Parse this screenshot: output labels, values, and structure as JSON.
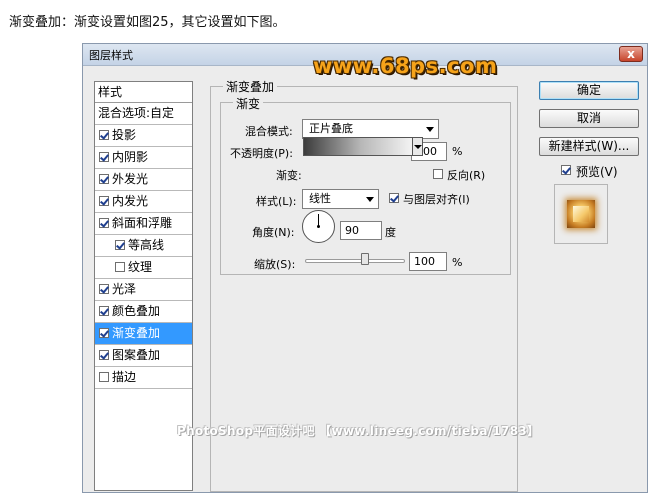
{
  "intro_text": "渐变叠加：渐变设置如图25，其它设置如下图。",
  "dialog": {
    "title": "图层样式",
    "close_glyph": "x",
    "logo": "www.68ps.com"
  },
  "styles_panel": {
    "header": "样式",
    "blend_options": "混合选项:自定",
    "items": [
      {
        "label": "投影",
        "checked": true
      },
      {
        "label": "内阴影",
        "checked": true
      },
      {
        "label": "外发光",
        "checked": true
      },
      {
        "label": "内发光",
        "checked": true
      },
      {
        "label": "斜面和浮雕",
        "checked": true
      },
      {
        "label": "等高线",
        "checked": true
      },
      {
        "label": "纹理",
        "checked": false
      },
      {
        "label": "光泽",
        "checked": true
      },
      {
        "label": "颜色叠加",
        "checked": true
      },
      {
        "label": "渐变叠加",
        "checked": true,
        "selected": true
      },
      {
        "label": "图案叠加",
        "checked": true
      },
      {
        "label": "描边",
        "checked": false
      }
    ]
  },
  "gradient_overlay": {
    "section_title": "渐变叠加",
    "subsection_title": "渐变",
    "blend_mode_label": "混合模式:",
    "blend_mode_value": "正片叠底",
    "opacity_label": "不透明度(P):",
    "opacity_value": "100",
    "opacity_unit": "%",
    "gradient_label": "渐变:",
    "reverse_label": "反向(R)",
    "reverse_checked": false,
    "style_label": "样式(L):",
    "style_value": "线性",
    "align_label": "与图层对齐(I)",
    "align_checked": true,
    "angle_label": "角度(N):",
    "angle_value": "90",
    "angle_unit": "度",
    "scale_label": "缩放(S):",
    "scale_value": "100",
    "scale_unit": "%"
  },
  "buttons": {
    "ok": "确定",
    "cancel": "取消",
    "new_style": "新建样式(W)...",
    "preview_label": "预览(V)",
    "preview_checked": true
  },
  "footer_watermark": "PhotoShop平面设计吧 【www.lineeg.com/tieba/1783】"
}
